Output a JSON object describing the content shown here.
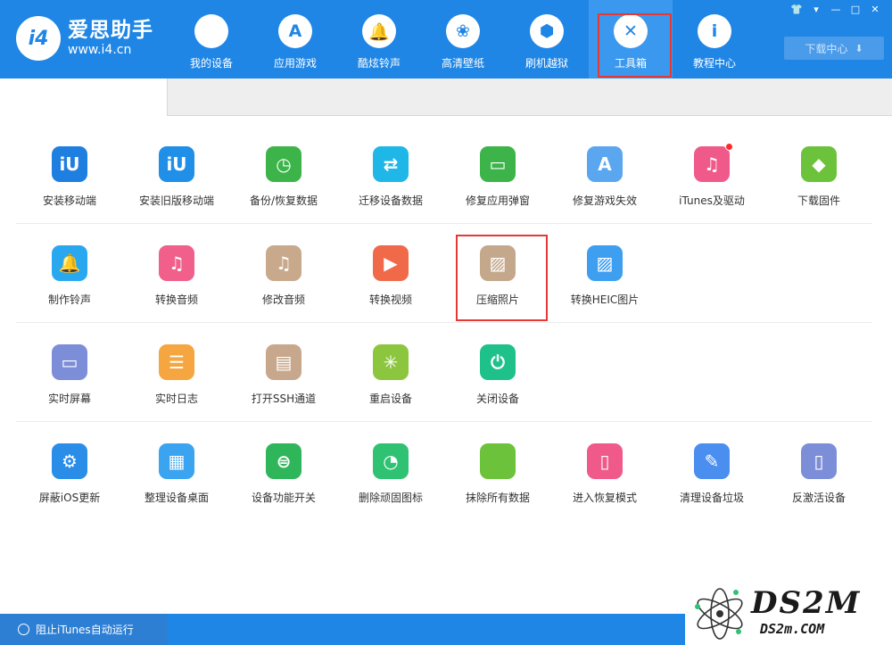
{
  "header": {
    "logo_mark": "i4",
    "logo_name": "爱思助手",
    "logo_url": "www.i4.cn",
    "nav": [
      {
        "label": "我的设备",
        "icon": "apple-icon",
        "glyph": ""
      },
      {
        "label": "应用游戏",
        "icon": "app-store-icon",
        "glyph": "A"
      },
      {
        "label": "酷炫铃声",
        "icon": "bell-icon",
        "glyph": "🔔"
      },
      {
        "label": "高清壁纸",
        "icon": "flower-icon",
        "glyph": "❀"
      },
      {
        "label": "刷机越狱",
        "icon": "dropbox-icon",
        "glyph": "⬢"
      },
      {
        "label": "工具箱",
        "icon": "tools-icon",
        "glyph": "✕"
      },
      {
        "label": "教程中心",
        "icon": "info-icon",
        "glyph": "i"
      }
    ],
    "active_nav": "工具箱",
    "download_label": "下载中心",
    "download_glyph": "⬇"
  },
  "window_controls": [
    "👕",
    "▾",
    "—",
    "□",
    "✕"
  ],
  "tools": [
    [
      {
        "label": "安装移动端",
        "icon": "i4-app-icon",
        "color": "#1f7fe0",
        "glyph": "iU"
      },
      {
        "label": "安装旧版移动端",
        "icon": "i4-legacy-app-icon",
        "color": "#1f8fe8",
        "glyph": "iU"
      },
      {
        "label": "备份/恢复数据",
        "icon": "backup-clock-icon",
        "color": "#3cb449",
        "glyph": "◷"
      },
      {
        "label": "迁移设备数据",
        "icon": "migrate-devices-icon",
        "color": "#1fb6e8",
        "glyph": "⇄"
      },
      {
        "label": "修复应用弹窗",
        "icon": "apple-id-icon",
        "color": "#3cb449",
        "glyph": "▭"
      },
      {
        "label": "修复游戏失效",
        "icon": "app-store-repair-icon",
        "color": "#5aa7f0",
        "glyph": "A"
      },
      {
        "label": "iTunes及驱动",
        "icon": "itunes-icon",
        "color": "#f05a8a",
        "glyph": "♫",
        "badge": true
      },
      {
        "label": "下载固件",
        "icon": "firmware-cube-icon",
        "color": "#6cc23a",
        "glyph": "◆"
      }
    ],
    [
      {
        "label": "制作铃声",
        "icon": "ringtone-bell-icon",
        "color": "#2aa8ef",
        "glyph": "🔔"
      },
      {
        "label": "转换音频",
        "icon": "music-convert-icon",
        "color": "#f0608a",
        "glyph": "♫"
      },
      {
        "label": "修改音频",
        "icon": "music-edit-icon",
        "color": "#c8a98c",
        "glyph": "♫"
      },
      {
        "label": "转换视频",
        "icon": "video-convert-icon",
        "color": "#f06a4a",
        "glyph": "▶"
      },
      {
        "label": "压缩照片",
        "icon": "photo-compress-icon",
        "color": "#c4a88c",
        "glyph": "▨"
      },
      {
        "label": "转换HEIC图片",
        "icon": "heic-convert-icon",
        "color": "#3e9ef0",
        "glyph": "▨"
      }
    ],
    [
      {
        "label": "实时屏幕",
        "icon": "monitor-icon",
        "color": "#7d8ed8",
        "glyph": "▭"
      },
      {
        "label": "实时日志",
        "icon": "log-document-icon",
        "color": "#f5a640",
        "glyph": "☰"
      },
      {
        "label": "打开SSH通道",
        "icon": "ssh-terminal-icon",
        "color": "#c8a88c",
        "glyph": "▤"
      },
      {
        "label": "重启设备",
        "icon": "restart-icon",
        "color": "#8cc63e",
        "glyph": "✳"
      },
      {
        "label": "关闭设备",
        "icon": "power-icon",
        "color": "#1fc18a",
        "glyph": "⏻"
      }
    ],
    [
      {
        "label": "屏蔽iOS更新",
        "icon": "block-update-gear-icon",
        "color": "#2a8de8",
        "glyph": "⚙"
      },
      {
        "label": "整理设备桌面",
        "icon": "desktop-grid-icon",
        "color": "#3aa4f0",
        "glyph": "▦"
      },
      {
        "label": "设备功能开关",
        "icon": "toggle-switch-icon",
        "color": "#2fb55a",
        "glyph": "⊜"
      },
      {
        "label": "删除顽固图标",
        "icon": "pie-delete-icon",
        "color": "#2fc273",
        "glyph": "◔"
      },
      {
        "label": "抹除所有数据",
        "icon": "erase-apple-icon",
        "color": "#6cc23a",
        "glyph": ""
      },
      {
        "label": "进入恢复模式",
        "icon": "recovery-mode-icon",
        "color": "#f05a8a",
        "glyph": "▯"
      },
      {
        "label": "清理设备垃圾",
        "icon": "broom-clean-icon",
        "color": "#4a8ef0",
        "glyph": "✎"
      },
      {
        "label": "反激活设备",
        "icon": "deactivate-device-icon",
        "color": "#7d8ed8",
        "glyph": "▯"
      }
    ]
  ],
  "status_bar": {
    "label": "阻止iTunes自动运行"
  },
  "watermark": {
    "main": "DS2M",
    "sub": "DS2m.COM"
  }
}
